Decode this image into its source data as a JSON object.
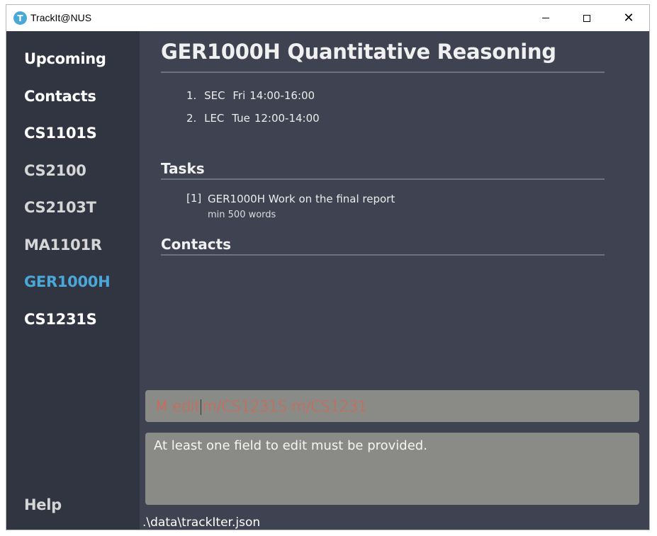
{
  "window": {
    "title": "TrackIt@NUS",
    "icon_letter": "T",
    "minimize_glyph": "",
    "close_glyph": "✕"
  },
  "sidebar": {
    "items": [
      {
        "label": "Upcoming"
      },
      {
        "label": "Contacts"
      },
      {
        "label": "CS1101S"
      },
      {
        "label": "CS2100"
      },
      {
        "label": "CS2103T"
      },
      {
        "label": "MA1101R"
      },
      {
        "label": "GER1000H"
      },
      {
        "label": "CS1231S"
      }
    ],
    "help_label": "Help",
    "active_item": "GER1000H",
    "accent_color": "#4aa8d8"
  },
  "module": {
    "title": "GER1000H Quantitative Reasoning",
    "lessons": [
      {
        "index": "1.",
        "type": "SEC",
        "day": "Fri",
        "time": "14:00-16:00"
      },
      {
        "index": "2.",
        "type": "LEC",
        "day": "Tue",
        "time": "12:00-14:00"
      }
    ]
  },
  "tasks_section": {
    "heading": "Tasks",
    "items": [
      {
        "index": "[1]",
        "title": "GER1000H Work on the final report",
        "description": "min 500 words"
      }
    ]
  },
  "contacts_section": {
    "heading": "Contacts"
  },
  "command": {
    "before_caret": "M edit",
    "after_caret": "m/CS1231S m/CS1231",
    "error_color": "#e55f45"
  },
  "result": {
    "message": "At least one field to edit must be provided."
  },
  "status_bar": {
    "file_path": ".\\data\\trackIter.json"
  }
}
